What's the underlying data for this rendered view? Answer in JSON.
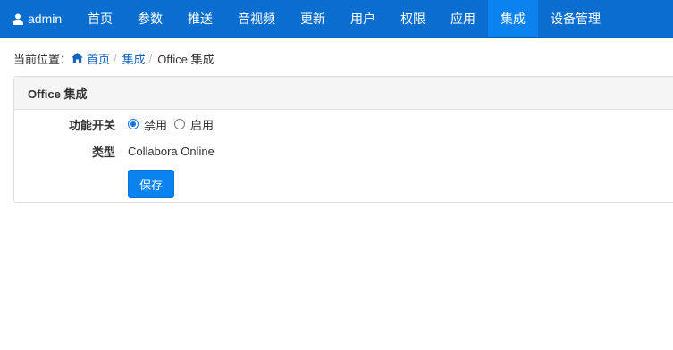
{
  "navbar": {
    "user": "admin",
    "items": [
      "首页",
      "参数",
      "推送",
      "音视频",
      "更新",
      "用户",
      "权限",
      "应用",
      "集成",
      "设备管理"
    ],
    "active_index": 8
  },
  "breadcrumb": {
    "prefix": "当前位置：",
    "home": "首页",
    "section": "集成",
    "current": "Office 集成"
  },
  "panel": {
    "title": "Office 集成",
    "switch_label": "功能开关",
    "switch_options": [
      "禁用",
      "启用"
    ],
    "switch_selected": "禁用",
    "type_label": "类型",
    "type_value": "Collabora Online",
    "save_label": "保存"
  },
  "colors": {
    "navbar": "#0a6ed1",
    "active": "#0a82f0",
    "link": "#1565c0"
  }
}
